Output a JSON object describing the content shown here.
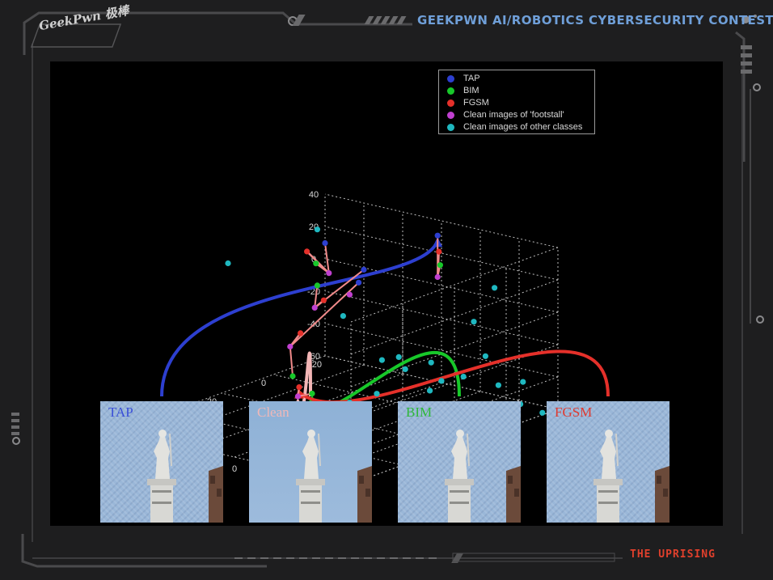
{
  "header": {
    "logo_text": "GeekPwn 极棒",
    "title": "GEEKPWN AI/ROBOTICS CYBERSECURITY CONTEST"
  },
  "footer": {
    "tagline": "THE UPRISING"
  },
  "colors": {
    "frame": "#4a4a4c",
    "accent_blue": "#6f9fd8",
    "accent_red": "#e0402c",
    "TAP": "#2d3fd0",
    "BIM": "#18c82a",
    "FGSM": "#e5302a",
    "clean_footstall": "#c040d0",
    "clean_other": "#1fb8c0"
  },
  "chart_data": {
    "type": "scatter",
    "projection": "3d",
    "grid": true,
    "legend_position": "top-right",
    "axes": {
      "z_ticks": [
        "40",
        "20",
        "0",
        "-20",
        "-40",
        "-60",
        "-40"
      ],
      "x_ticks": [
        "-20",
        "0",
        "20",
        "40",
        "60"
      ],
      "y_ticks": [
        "60",
        "40",
        "20",
        "0",
        "-20",
        "-40",
        "-60"
      ],
      "x_range": [
        -20,
        60
      ],
      "y_range": [
        -60,
        60
      ],
      "z_range": [
        -60,
        40
      ]
    },
    "series": [
      {
        "name": "TAP",
        "color": "#2d3fd0",
        "points": [
          [
            -14,
            -6,
            36
          ],
          [
            10,
            20,
            38
          ],
          [
            28,
            -24,
            44
          ],
          [
            33,
            -28,
            40
          ]
        ]
      },
      {
        "name": "BIM",
        "color": "#18c82a",
        "points": [
          [
            -12,
            -10,
            20
          ],
          [
            12,
            22,
            26
          ],
          [
            22,
            8,
            22
          ],
          [
            30,
            10,
            -30
          ],
          [
            30,
            0,
            -38
          ]
        ]
      },
      {
        "name": "FGSM",
        "color": "#e5302a",
        "points": [
          [
            -10,
            -12,
            30
          ],
          [
            14,
            24,
            34
          ],
          [
            18,
            10,
            10
          ],
          [
            24,
            14,
            -8
          ],
          [
            32,
            4,
            -34
          ]
        ]
      },
      {
        "name": "Clean images of 'footstall'",
        "color": "#c040d0",
        "points": [
          [
            -8,
            -14,
            16
          ],
          [
            10,
            18,
            20
          ],
          [
            20,
            12,
            6
          ],
          [
            28,
            14,
            -14
          ],
          [
            34,
            2,
            -38
          ],
          [
            38,
            -30,
            36
          ]
        ]
      },
      {
        "name": "Clean images of other classes",
        "color": "#1fb8c0",
        "points": [
          [
            -18,
            -30,
            8
          ],
          [
            -16,
            -22,
            -14
          ],
          [
            -10,
            -36,
            -28
          ],
          [
            -6,
            -30,
            -40
          ],
          [
            -2,
            -24,
            -42
          ],
          [
            4,
            -26,
            -44
          ],
          [
            -4,
            -16,
            -34
          ],
          [
            0,
            -8,
            -38
          ],
          [
            6,
            -4,
            -30
          ],
          [
            10,
            -18,
            -22
          ],
          [
            14,
            -12,
            -44
          ],
          [
            -12,
            -40,
            -46
          ],
          [
            -20,
            -42,
            -48
          ],
          [
            -22,
            -38,
            -64
          ],
          [
            12,
            -34,
            -56
          ],
          [
            20,
            -10,
            -50
          ],
          [
            26,
            -14,
            -42
          ],
          [
            18,
            2,
            -52
          ],
          [
            36,
            -24,
            20
          ],
          [
            24,
            -20,
            -60
          ],
          [
            -26,
            -44,
            -70
          ],
          [
            40,
            30,
            40
          ],
          [
            -2,
            40,
            34
          ]
        ]
      }
    ],
    "arrows_from_images": [
      {
        "image": "TAP",
        "color": "#2d3fd0"
      },
      {
        "image": "Clean",
        "color": "#f3b6b6"
      },
      {
        "image": "BIM",
        "color": "#18c82a"
      },
      {
        "image": "FGSM",
        "color": "#e5302a"
      }
    ]
  },
  "images": [
    {
      "label": "TAP",
      "label_color": "#3a4fd8",
      "noisy": true
    },
    {
      "label": "Clean",
      "label_color": "#f0b8b8",
      "noisy": false
    },
    {
      "label": "BIM",
      "label_color": "#2fb83a",
      "noisy": true
    },
    {
      "label": "FGSM",
      "label_color": "#e03a30",
      "noisy": true
    }
  ]
}
